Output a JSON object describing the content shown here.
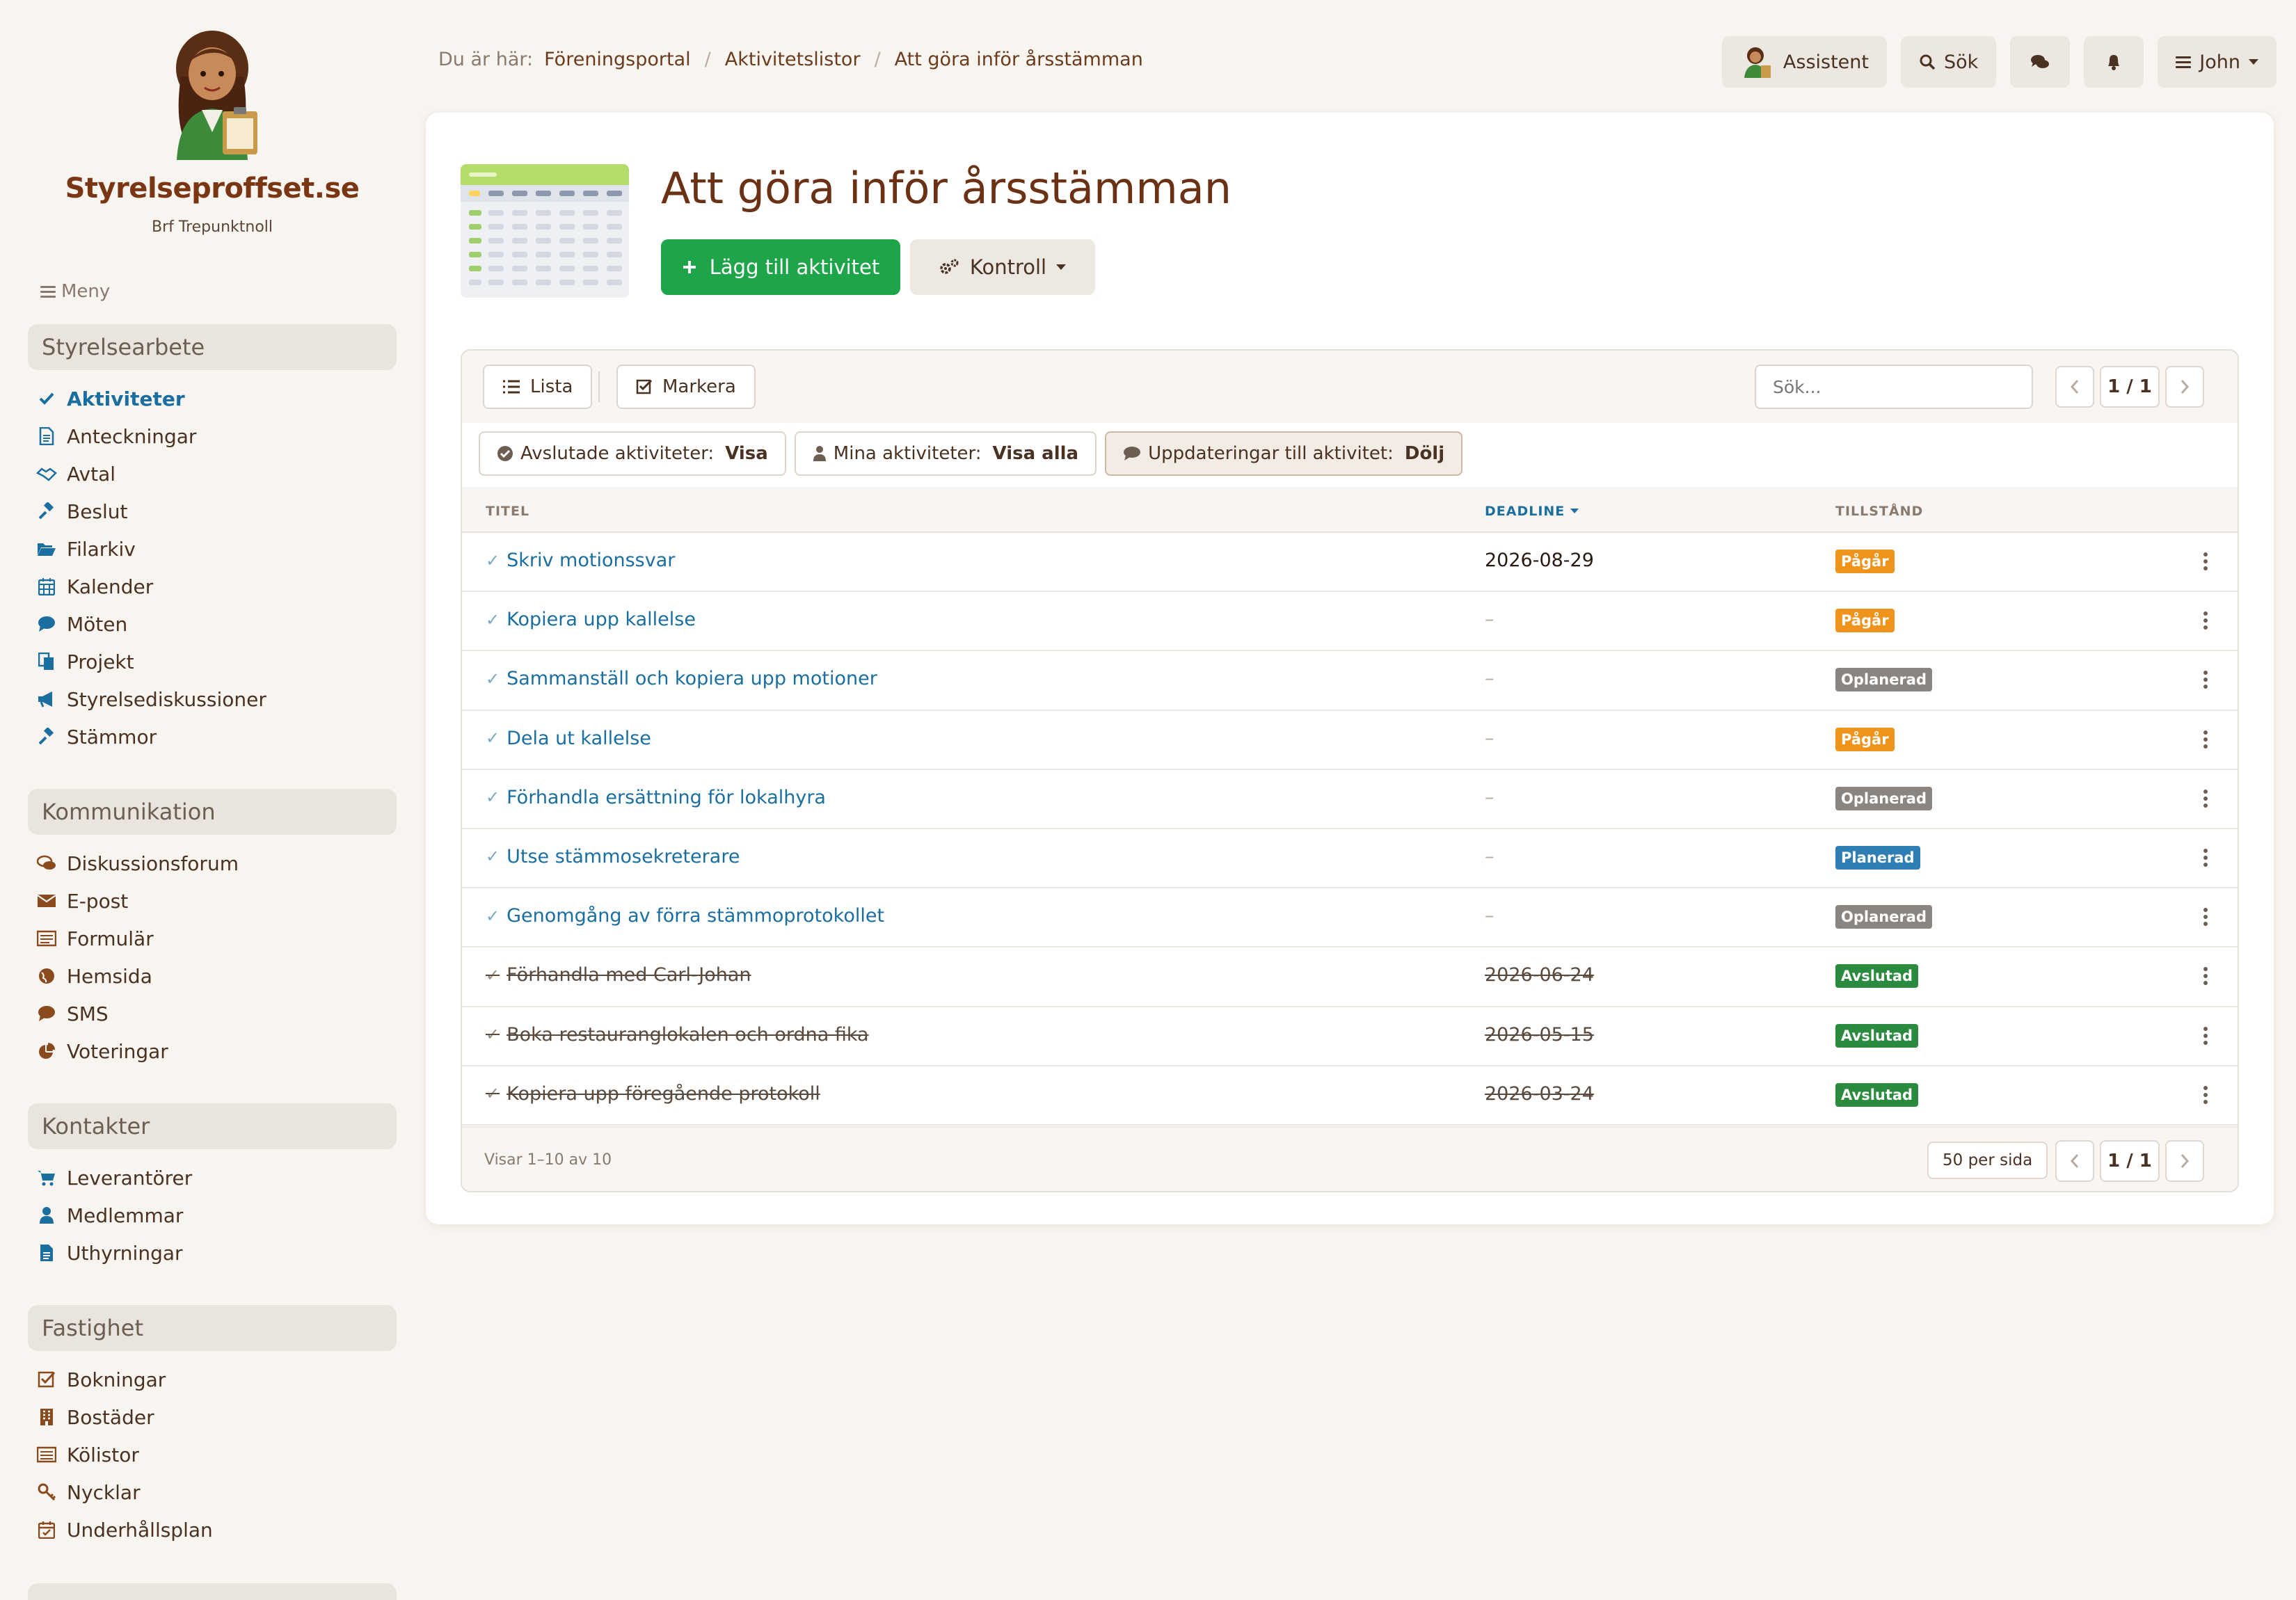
{
  "sidebar": {
    "brand": "Styrelseproffset.se",
    "org": "Brf Trepunktnoll",
    "menu_label": "Meny",
    "sections": [
      {
        "title": "Styrelsearbete",
        "items": [
          {
            "label": "Aktiviteter",
            "icon": "check-icon",
            "active": true
          },
          {
            "label": "Anteckningar",
            "icon": "document-icon"
          },
          {
            "label": "Avtal",
            "icon": "handshake-icon"
          },
          {
            "label": "Beslut",
            "icon": "gavel-icon"
          },
          {
            "label": "Filarkiv",
            "icon": "folder-open-icon"
          },
          {
            "label": "Kalender",
            "icon": "calendar-icon"
          },
          {
            "label": "Möten",
            "icon": "speech-bubble-icon"
          },
          {
            "label": "Projekt",
            "icon": "copy-icon"
          },
          {
            "label": "Styrelsediskussioner",
            "icon": "megaphone-icon"
          },
          {
            "label": "Stämmor",
            "icon": "gavel-icon"
          }
        ]
      },
      {
        "title": "Kommunikation",
        "items": [
          {
            "label": "Diskussionsforum",
            "icon": "comments-icon"
          },
          {
            "label": "E-post",
            "icon": "envelope-icon"
          },
          {
            "label": "Formulär",
            "icon": "form-list-icon"
          },
          {
            "label": "Hemsida",
            "icon": "globe-icon"
          },
          {
            "label": "SMS",
            "icon": "chat-icon"
          },
          {
            "label": "Voteringar",
            "icon": "pie-chart-icon"
          }
        ]
      },
      {
        "title": "Kontakter",
        "items": [
          {
            "label": "Leverantörer",
            "icon": "cart-icon"
          },
          {
            "label": "Medlemmar",
            "icon": "user-icon"
          },
          {
            "label": "Uthyrningar",
            "icon": "file-icon"
          }
        ]
      },
      {
        "title": "Fastighet",
        "items": [
          {
            "label": "Bokningar",
            "icon": "checkbox-icon"
          },
          {
            "label": "Bostäder",
            "icon": "building-icon"
          },
          {
            "label": "Kölistor",
            "icon": "list-icon"
          },
          {
            "label": "Nycklar",
            "icon": "key-icon"
          },
          {
            "label": "Underhållsplan",
            "icon": "calendar-check-icon"
          }
        ]
      }
    ]
  },
  "breadcrumb": {
    "prefix": "Du är här:",
    "items": [
      "Föreningsportal",
      "Aktivitetslistor",
      "Att göra inför årsstämman"
    ]
  },
  "topbar": {
    "assistant": "Assistent",
    "search": "Sök",
    "user": "John"
  },
  "page": {
    "title": "Att göra inför årsstämman",
    "add_button": "Lägg till aktivitet",
    "control_button": "Kontroll"
  },
  "table": {
    "view_list": "Lista",
    "view_mark": "Markera",
    "search_placeholder": "Sök...",
    "page_indicator": "1 / 1",
    "filters": [
      {
        "label": "Avslutade aktiviteter:",
        "value": "Visa",
        "icon": "circle-check-icon"
      },
      {
        "label": "Mina aktiviteter:",
        "value": "Visa alla",
        "icon": "user-icon"
      },
      {
        "label": "Uppdateringar till aktivitet:",
        "value": "Dölj",
        "icon": "comment-icon"
      }
    ],
    "columns": {
      "title": "TITEL",
      "deadline": "DEADLINE",
      "state": "TILLSTÅND"
    },
    "rows": [
      {
        "title": "Skriv motionssvar",
        "deadline": "2026-08-29",
        "status": "Pågår",
        "status_color": "#f0931a",
        "done": false
      },
      {
        "title": "Kopiera upp kallelse",
        "deadline": "–",
        "status": "Pågår",
        "status_color": "#f0931a",
        "done": false
      },
      {
        "title": "Sammanställ och kopiera upp motioner",
        "deadline": "–",
        "status": "Oplanerad",
        "status_color": "#8a8580",
        "done": false
      },
      {
        "title": "Dela ut kallelse",
        "deadline": "–",
        "status": "Pågår",
        "status_color": "#f0931a",
        "done": false
      },
      {
        "title": "Förhandla ersättning för lokalhyra",
        "deadline": "–",
        "status": "Oplanerad",
        "status_color": "#8a8580",
        "done": false
      },
      {
        "title": "Utse stämmosekreterare",
        "deadline": "–",
        "status": "Planerad",
        "status_color": "#2f7fb5",
        "done": false
      },
      {
        "title": "Genomgång av förra stämmoprotokollet",
        "deadline": "–",
        "status": "Oplanerad",
        "status_color": "#8a8580",
        "done": false
      },
      {
        "title": "Förhandla med Carl-Johan",
        "deadline": "2026-06-24",
        "status": "Avslutad",
        "status_color": "#2a8a3e",
        "done": true
      },
      {
        "title": "Boka restauranglokalen och ordna fika",
        "deadline": "2026-05-15",
        "status": "Avslutad",
        "status_color": "#2a8a3e",
        "done": true
      },
      {
        "title": "Kopiera upp föregående protokoll",
        "deadline": "2026-03-24",
        "status": "Avslutad",
        "status_color": "#2a8a3e",
        "done": true
      }
    ],
    "footer_info": "Visar 1–10 av 10",
    "per_page": "50 per sida"
  }
}
